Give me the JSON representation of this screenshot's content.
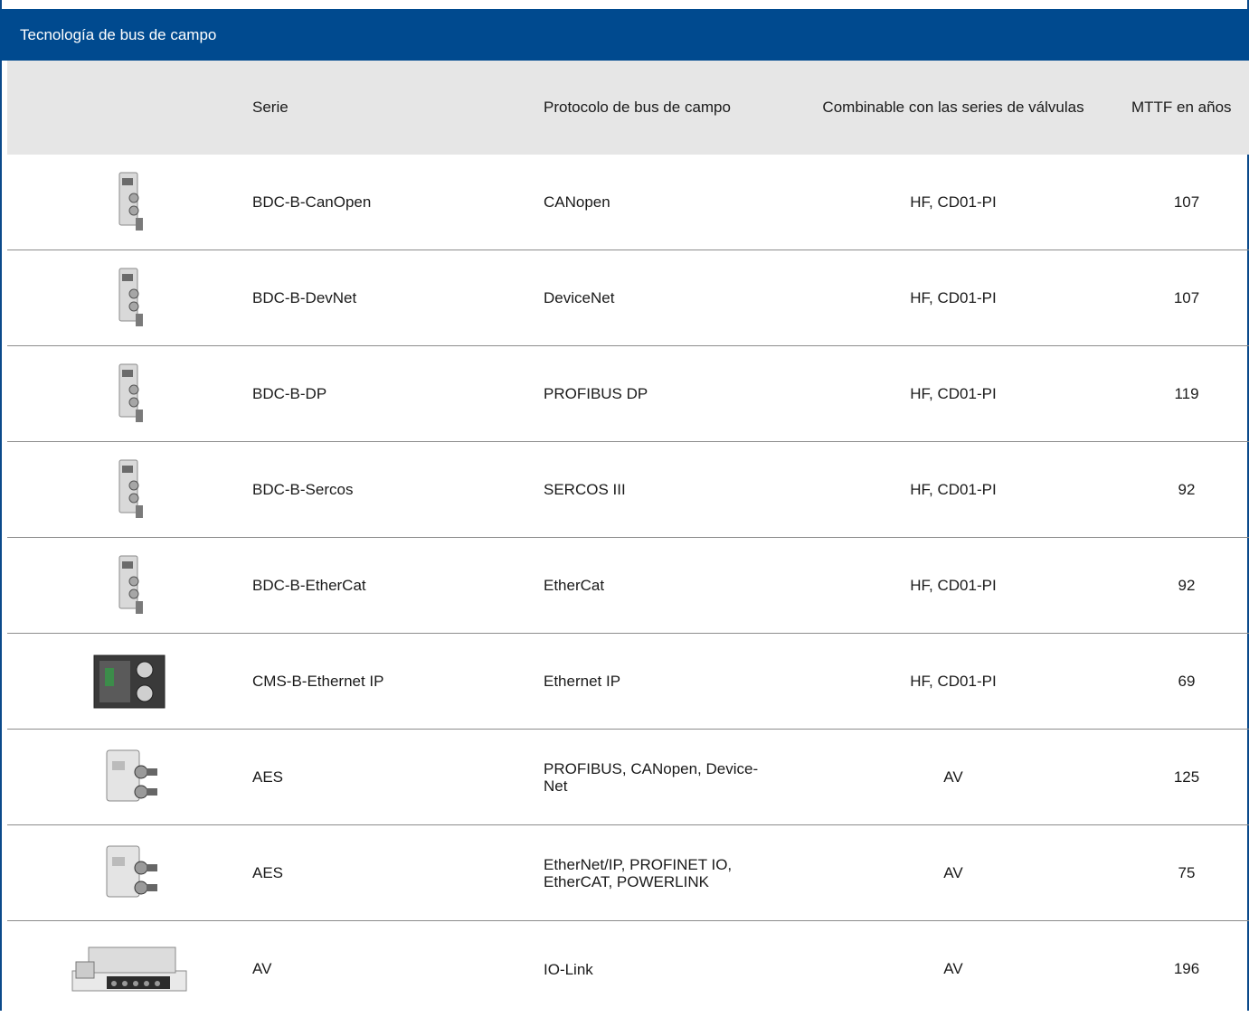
{
  "title": "Tecnología de bus de campo",
  "headers": {
    "serie": "Serie",
    "protocol": "Protocolo de bus de campo",
    "combinable": "Combinable con las series de válvulas",
    "mttf": "MTTF en años"
  },
  "rows": [
    {
      "icon": "bdc-module-icon",
      "serie": "BDC-B-CanOpen",
      "protocol": "CANopen",
      "combinable": "HF, CD01-PI",
      "mttf": "107"
    },
    {
      "icon": "bdc-module-icon",
      "serie": "BDC-B-DevNet",
      "protocol": "DeviceNet",
      "combinable": "HF, CD01-PI",
      "mttf": "107"
    },
    {
      "icon": "bdc-module-icon",
      "serie": "BDC-B-DP",
      "protocol": "PROFIBUS DP",
      "combinable": "HF, CD01-PI",
      "mttf": "119"
    },
    {
      "icon": "bdc-module-icon",
      "serie": "BDC-B-Sercos",
      "protocol": "SERCOS III",
      "combinable": "HF, CD01-PI",
      "mttf": "92"
    },
    {
      "icon": "bdc-module-icon",
      "serie": "BDC-B-EtherCat",
      "protocol": "EtherCat",
      "combinable": "HF, CD01-PI",
      "mttf": "92"
    },
    {
      "icon": "cms-module-icon",
      "serie": "CMS-B-Ethernet IP",
      "protocol": "Ethernet IP",
      "combinable": "HF, CD01-PI",
      "mttf": "69"
    },
    {
      "icon": "aes-module-icon",
      "serie": "AES",
      "protocol": "PROFIBUS, CANopen, Device-\nNet",
      "combinable": "AV",
      "mttf": "125"
    },
    {
      "icon": "aes-module-icon",
      "serie": "AES",
      "protocol": "EtherNet/IP, PROFINET IO,\nEtherCAT, POWERLINK",
      "combinable": "AV",
      "mttf": "75"
    },
    {
      "icon": "av-valve-manifold-icon",
      "serie": "AV",
      "protocol": "IO-Link",
      "combinable": "AV",
      "mttf": "196"
    }
  ]
}
